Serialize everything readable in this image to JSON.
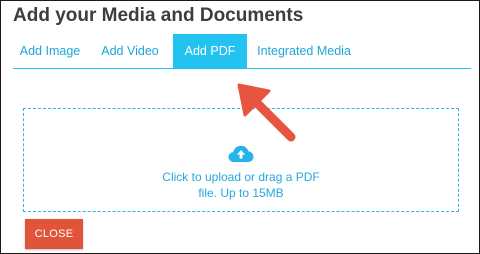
{
  "dialog": {
    "title": "Add your Media and Documents"
  },
  "tabs": [
    {
      "label": "Add Image",
      "active": false
    },
    {
      "label": "Add Video",
      "active": false
    },
    {
      "label": "Add PDF",
      "active": true
    },
    {
      "label": "Integrated Media",
      "active": false
    }
  ],
  "upload": {
    "icon": "cloud-upload-icon",
    "line1": "Click to upload or drag a PDF",
    "line2": "file. Up to 15MB"
  },
  "close_button": {
    "label": "CLOSE"
  },
  "annotation": {
    "icon": "pointer-arrow-icon"
  },
  "colors": {
    "accent": "#22c2f1",
    "tab_text": "#1fa6d9",
    "close": "#e0543a",
    "arrow": "#e8553f"
  }
}
